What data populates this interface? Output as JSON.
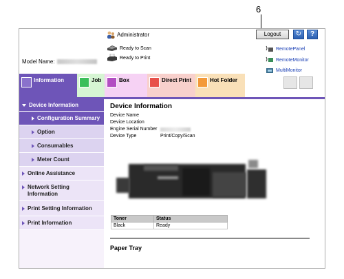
{
  "callout": {
    "number": "6"
  },
  "header": {
    "user": "Administrator",
    "status": [
      "Ready to Scan",
      "Ready to Print"
    ],
    "model_label": "Model Name:",
    "logout": "Logout",
    "help": "?",
    "links": [
      "RemotePanel",
      "RemoteMonitor",
      "MultiMonitor"
    ]
  },
  "tabs": [
    "Information",
    "Job",
    "Box",
    "Direct Print",
    "Hot Folder"
  ],
  "sidebar": {
    "top": "Device Information",
    "subitems": [
      "Configuration Summary",
      "Option",
      "Consumables",
      "Meter Count"
    ],
    "items": [
      "Online Assistance",
      "Network Setting Information",
      "Print Setting Information",
      "Print Information"
    ]
  },
  "main": {
    "title": "Device Information",
    "rows": [
      {
        "label": "Device Name",
        "value": ""
      },
      {
        "label": "Device Location",
        "value": ""
      },
      {
        "label": "Engine Serial Number",
        "value": ""
      },
      {
        "label": "Device Type",
        "value": "Print/Copy/Scan"
      }
    ],
    "table": {
      "headers": [
        "Toner",
        "Status"
      ],
      "rows": [
        [
          "Black",
          "Ready"
        ]
      ]
    },
    "paper_tray": "Paper Tray"
  },
  "colors": {
    "accent": "#6e55b8",
    "link": "#1a3fb5"
  }
}
